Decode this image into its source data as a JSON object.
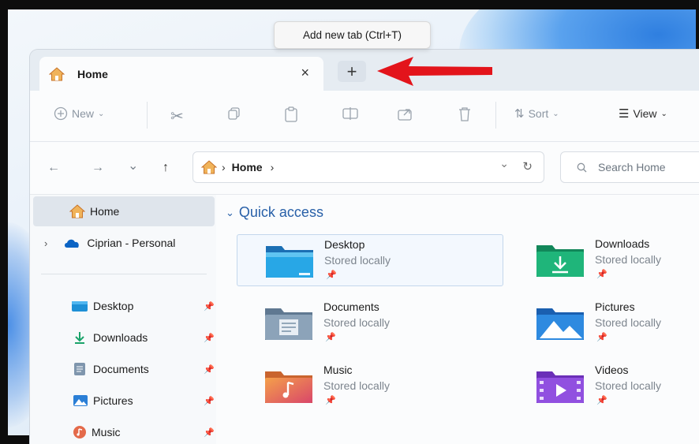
{
  "tooltip": "Add new tab (Ctrl+T)",
  "tab": {
    "label": "Home",
    "close": "×"
  },
  "new_tab": "+",
  "toolbar": {
    "new_label": "New",
    "sort_label": "Sort",
    "view_label": "View"
  },
  "nav": {
    "back": "←",
    "forward": "→",
    "recent": "⌄",
    "up": "↑",
    "path_sep": "›",
    "path": "Home",
    "path_sep2": "›",
    "dropdown": "⌄",
    "refresh": "↻"
  },
  "search": {
    "placeholder": "Search Home"
  },
  "sidebar": {
    "home": "Home",
    "cloud": "Ciprian - Personal",
    "items": [
      {
        "label": "Desktop",
        "pin": "📌"
      },
      {
        "label": "Downloads",
        "pin": "📌"
      },
      {
        "label": "Documents",
        "pin": "📌"
      },
      {
        "label": "Pictures",
        "pin": "📌"
      },
      {
        "label": "Music",
        "pin": "📌"
      }
    ]
  },
  "quick_access": {
    "title": "Quick access",
    "folders": [
      {
        "name": "Desktop",
        "status": "Stored locally"
      },
      {
        "name": "Downloads",
        "status": "Stored locally"
      },
      {
        "name": "Documents",
        "status": "Stored locally"
      },
      {
        "name": "Pictures",
        "status": "Stored locally"
      },
      {
        "name": "Music",
        "status": "Stored locally"
      },
      {
        "name": "Videos",
        "status": "Stored locally"
      }
    ]
  },
  "colors": {
    "accent": "#2860a8",
    "arrow": "#e3141b"
  }
}
